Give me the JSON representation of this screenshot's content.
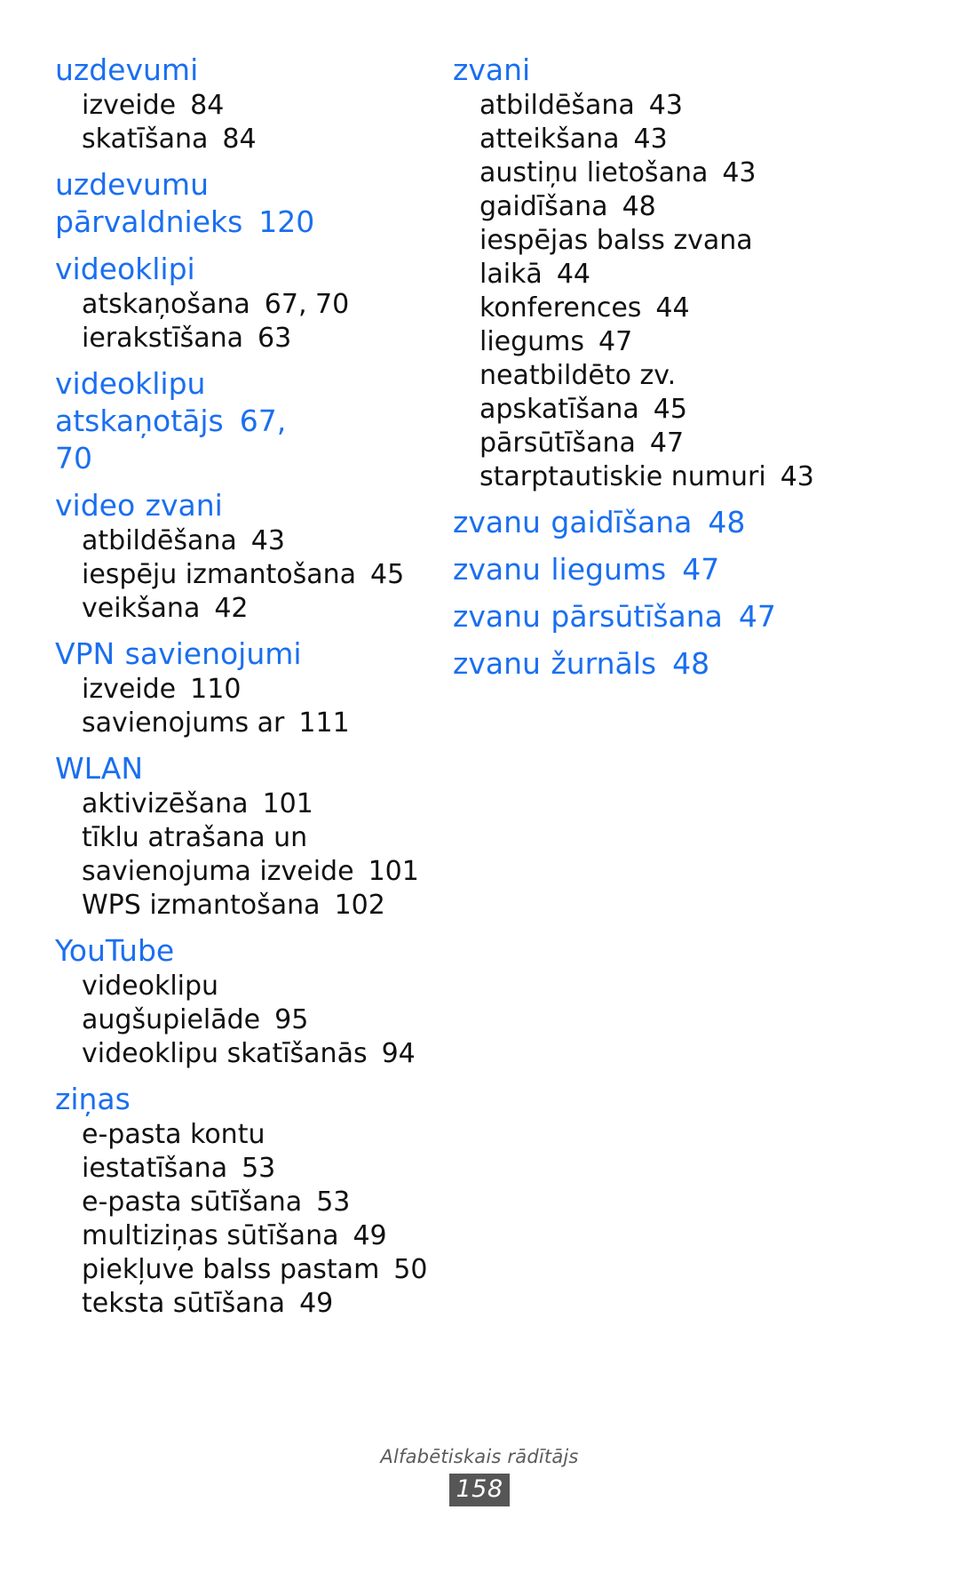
{
  "colors": {
    "heading_blue": "#1a6ff0",
    "body_black": "#111111",
    "footer_gray": "#5b5b5b",
    "page_box_bg": "#565656",
    "page_box_text": "#ffffff",
    "background": "#ffffff"
  },
  "footer": {
    "label": "Alfabētiskais rādītājs",
    "page_number": "158"
  },
  "left_column": {
    "entries": [
      {
        "type": "heading",
        "label": "uzdevumi",
        "page": ""
      },
      {
        "type": "sub",
        "label": "izveide",
        "page": "84"
      },
      {
        "type": "sub",
        "label": "skatīšana",
        "page": "84"
      },
      {
        "type": "heading",
        "label": "uzdevumu",
        "page": ""
      },
      {
        "type": "heading-cont",
        "label": "pārvaldnieks",
        "page": "120"
      },
      {
        "type": "heading",
        "label": "videoklipi",
        "page": ""
      },
      {
        "type": "sub",
        "label": "atskaņošana",
        "page": "67, 70"
      },
      {
        "type": "sub",
        "label": "ierakstīšana",
        "page": "63"
      },
      {
        "type": "heading",
        "label": "videoklipu atskaņotājs",
        "page": "67,"
      },
      {
        "type": "heading-cont",
        "label": "70",
        "page": ""
      },
      {
        "type": "heading",
        "label": "video zvani",
        "page": ""
      },
      {
        "type": "sub",
        "label": "atbildēšana",
        "page": "43"
      },
      {
        "type": "sub",
        "label": "iespēju izmantošana",
        "page": "45"
      },
      {
        "type": "sub",
        "label": "veikšana",
        "page": "42"
      },
      {
        "type": "heading",
        "label": "VPN savienojumi",
        "page": ""
      },
      {
        "type": "sub",
        "label": "izveide",
        "page": "110"
      },
      {
        "type": "sub",
        "label": "savienojums ar",
        "page": "111"
      },
      {
        "type": "heading",
        "label": "WLAN",
        "page": ""
      },
      {
        "type": "sub",
        "label": "aktivizēšana",
        "page": "101"
      },
      {
        "type": "sub",
        "label": "tīklu atrašana un",
        "page": ""
      },
      {
        "type": "sub-cont",
        "label": "savienojuma izveide",
        "page": "101"
      },
      {
        "type": "sub",
        "label": "WPS izmantošana",
        "page": "102"
      },
      {
        "type": "heading",
        "label": "YouTube",
        "page": ""
      },
      {
        "type": "sub",
        "label": "videoklipu",
        "page": ""
      },
      {
        "type": "sub-cont",
        "label": "augšupielāde",
        "page": "95"
      },
      {
        "type": "sub",
        "label": "videoklipu skatīšanās",
        "page": "94"
      },
      {
        "type": "heading",
        "label": "ziņas",
        "page": ""
      },
      {
        "type": "sub",
        "label": "e-pasta kontu",
        "page": ""
      },
      {
        "type": "sub-cont",
        "label": "iestatīšana",
        "page": "53"
      },
      {
        "type": "sub",
        "label": "e-pasta sūtīšana",
        "page": "53"
      },
      {
        "type": "sub",
        "label": "multiziņas sūtīšana",
        "page": "49"
      },
      {
        "type": "sub",
        "label": "piekļuve balss pastam",
        "page": "50"
      },
      {
        "type": "sub",
        "label": "teksta sūtīšana",
        "page": "49"
      }
    ]
  },
  "right_column": {
    "entries": [
      {
        "type": "heading",
        "label": "zvani",
        "page": ""
      },
      {
        "type": "sub",
        "label": "atbildēšana",
        "page": "43"
      },
      {
        "type": "sub",
        "label": "atteikšana",
        "page": "43"
      },
      {
        "type": "sub",
        "label": "austiņu lietošana",
        "page": "43"
      },
      {
        "type": "sub",
        "label": "gaidīšana",
        "page": "48"
      },
      {
        "type": "sub",
        "label": "iespējas balss zvana",
        "page": ""
      },
      {
        "type": "sub-cont",
        "label": "laikā",
        "page": "44"
      },
      {
        "type": "sub",
        "label": "konferences",
        "page": "44"
      },
      {
        "type": "sub",
        "label": "liegums",
        "page": "47"
      },
      {
        "type": "sub",
        "label": "neatbildēto zv.",
        "page": ""
      },
      {
        "type": "sub-cont",
        "label": "apskatīšana",
        "page": "45"
      },
      {
        "type": "sub",
        "label": "pārsūtīšana",
        "page": "47"
      },
      {
        "type": "sub",
        "label": "starptautiskie numuri",
        "page": "43"
      },
      {
        "type": "heading",
        "label": "zvanu gaidīšana",
        "page": "48"
      },
      {
        "type": "heading",
        "label": "zvanu liegums",
        "page": "47"
      },
      {
        "type": "heading",
        "label": "zvanu pārsūtīšana",
        "page": "47"
      },
      {
        "type": "heading",
        "label": "zvanu žurnāls",
        "page": "48"
      }
    ]
  }
}
